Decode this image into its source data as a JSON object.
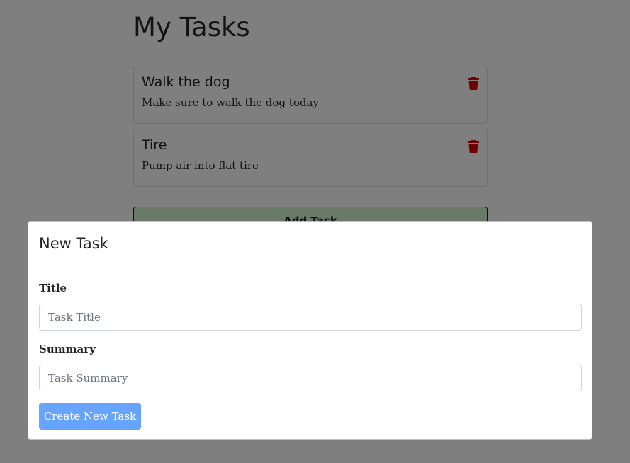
{
  "page": {
    "title": "My Tasks"
  },
  "tasks": [
    {
      "title": "Walk the dog",
      "summary": "Make sure to walk the dog today",
      "delete_icon": "trash-icon"
    },
    {
      "title": "Tire",
      "summary": "Pump air into flat tire",
      "delete_icon": "trash-icon"
    }
  ],
  "add_task_button": {
    "label": "Add Task"
  },
  "modal": {
    "title": "New Task",
    "title_field": {
      "label": "Title",
      "value": "",
      "placeholder": "Task Title"
    },
    "summary_field": {
      "label": "Summary",
      "value": "",
      "placeholder": "Task Summary"
    },
    "submit_label": "Create New Task"
  },
  "colors": {
    "delete_icon": "#dc0000",
    "add_button_bg": "#d2f5d2",
    "create_button_bg": "#67a4ff",
    "backdrop": "rgba(0,0,0,0.5)"
  }
}
